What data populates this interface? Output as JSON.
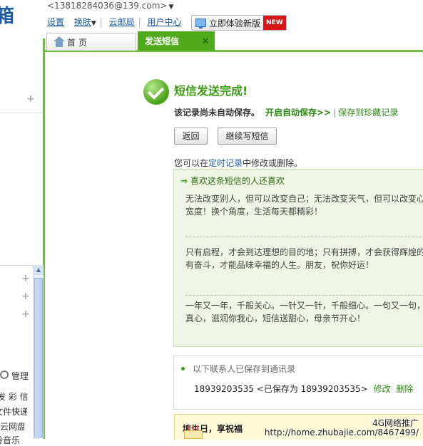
{
  "header": {
    "logo": "箱",
    "account": "<13818284036@139.com>",
    "nav": [
      "设置",
      "换肤",
      "云邮局",
      "用户中心"
    ],
    "trial_button": "立即体验新版",
    "new_badge": "NEW"
  },
  "tabs": [
    {
      "label": "首 页"
    },
    {
      "label": "发送短信",
      "close": "×"
    }
  ],
  "sidebar": {
    "management": "管理",
    "items": [
      "发 彩 信",
      "文件快递",
      "彩云网盘",
      "铃音乐"
    ]
  },
  "main": {
    "success_title": "短信发送完成!",
    "save_notice": "该记录尚未自动保存。",
    "auto_save_link": "开启自动保存>>",
    "separator": "|",
    "save_favorite_link": "保存到珍藏记录",
    "back_button": "返回",
    "continue_button": "继续写短信",
    "edit_prefix": "您可以在",
    "edit_link": "定时记录",
    "edit_suffix": "中修改或删除。",
    "like_header": "喜欢这条短信的人还喜欢",
    "messages": [
      {
        "line1": "无法改变别人，但可以改变自己；无法改变天气，但可以改变心",
        "line2": "宽度！换个角度，生活每天都精彩！"
      },
      {
        "line1": "只有启程，才会到达理想的目的地；只有拼搏，才会获得辉煌的",
        "line2": "有奋斗，才能品味幸福的人生。朋友，祝你好运！"
      },
      {
        "line1": "一年又一年，千般关心。一针又一针，千般细心。一句又一句，",
        "line2": "真心，滋润你我心，短信送甜心，母亲节开心！"
      }
    ],
    "saved_label": "以下联系人已保存到通讯录",
    "saved_entry": "18939203535 <已保存为 18939203535>",
    "edit_action": "修改",
    "delete_action": "删除",
    "birthday_title": "填生日，享祝福"
  },
  "watermark": {
    "line1": "4G网络推广",
    "line2": "http://home.zhubajie.com/8467499/"
  }
}
